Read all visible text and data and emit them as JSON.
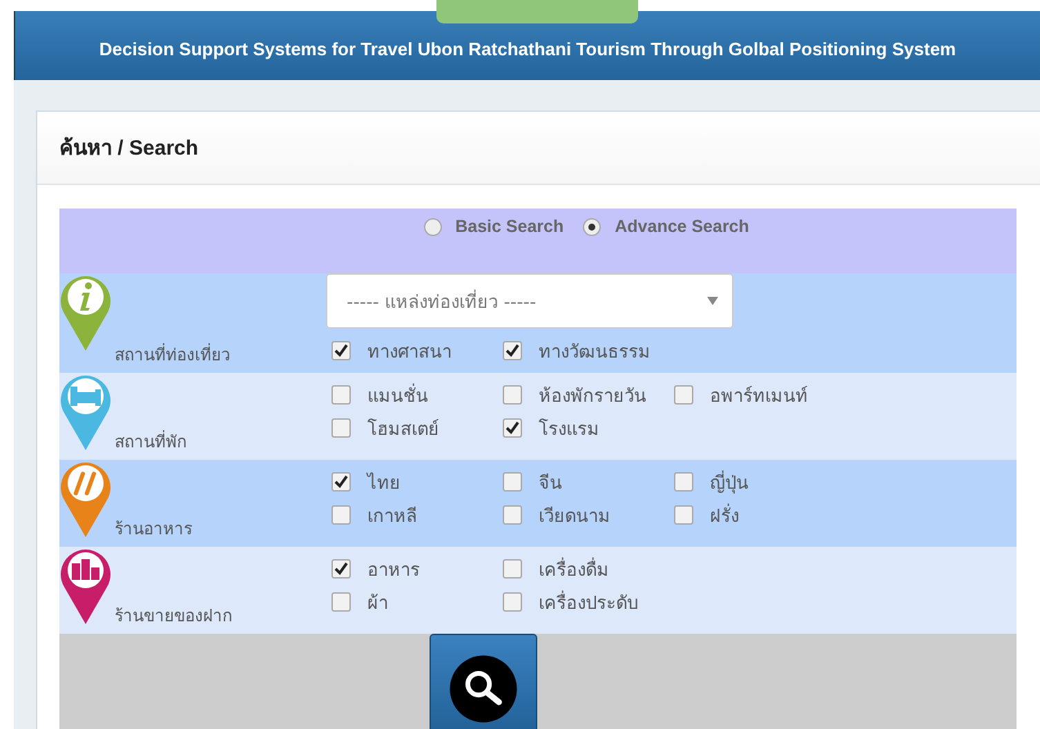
{
  "header": {
    "title": "Decision Support Systems for Travel Ubon Ratchathani Tourism Through Golbal Positioning System"
  },
  "panel": {
    "title": "ค้นหา / Search"
  },
  "search_modes": [
    {
      "label": "Basic Search",
      "selected": false
    },
    {
      "label": "Advance Search",
      "selected": true
    }
  ],
  "categories": [
    {
      "label": "สถานที่ท่องเที่ยว",
      "kind": "info",
      "color": "#8cb43c",
      "select": {
        "placeholder": "----- แหล่งท่องเที่ยว -----"
      },
      "options": [
        {
          "label": "ทางศาสนา",
          "checked": true
        },
        {
          "label": "ทางวัฒนธรรม",
          "checked": true
        }
      ]
    },
    {
      "label": "สถานที่พัก",
      "kind": "bed",
      "color": "#4ab8e0",
      "options": [
        {
          "label": "แมนชั่น",
          "checked": false
        },
        {
          "label": "ห้องพักรายวัน",
          "checked": false
        },
        {
          "label": "อพาร์ทเมนท์",
          "checked": false
        },
        {
          "label": "โฮมสเตย์",
          "checked": false
        },
        {
          "label": "โรงแรม",
          "checked": true
        }
      ]
    },
    {
      "label": "ร้านอาหาร",
      "kind": "food",
      "color": "#e8831a",
      "options": [
        {
          "label": "ไทย",
          "checked": true
        },
        {
          "label": "จีน",
          "checked": false
        },
        {
          "label": "ญี่ปุ่น",
          "checked": false
        },
        {
          "label": "เกาหลี",
          "checked": false
        },
        {
          "label": "เวียดนาม",
          "checked": false
        },
        {
          "label": "ฝรั่ง",
          "checked": false
        }
      ]
    },
    {
      "label": "ร้านขายของฝาก",
      "kind": "shop",
      "color": "#c81e6a",
      "options": [
        {
          "label": "อาหาร",
          "checked": true
        },
        {
          "label": "เครื่องดื่ม",
          "checked": false
        },
        {
          "label": "ผ้า",
          "checked": false
        },
        {
          "label": "เครื่องประดับ",
          "checked": false
        }
      ]
    }
  ]
}
